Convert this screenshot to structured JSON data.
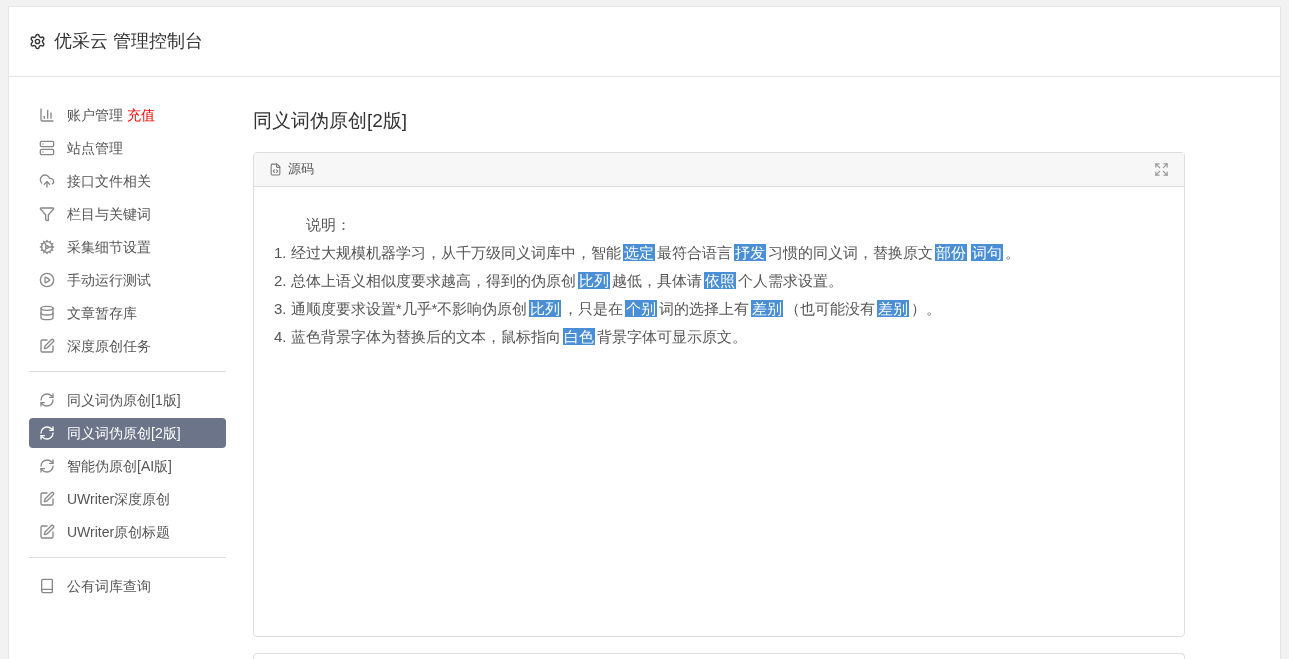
{
  "header": {
    "title": "优采云 管理控制台"
  },
  "sidebar": {
    "groups": [
      [
        {
          "label": "账户管理",
          "badge": "充值",
          "selected": false
        },
        {
          "label": "站点管理",
          "selected": false
        },
        {
          "label": "接口文件相关",
          "selected": false
        },
        {
          "label": "栏目与关键词",
          "selected": false
        },
        {
          "label": "采集细节设置",
          "selected": false
        },
        {
          "label": "手动运行测试",
          "selected": false
        },
        {
          "label": "文章暂存库",
          "selected": false
        },
        {
          "label": "深度原创任务",
          "selected": false
        }
      ],
      [
        {
          "label": "同义词伪原创[1版]",
          "selected": false
        },
        {
          "label": "同义词伪原创[2版]",
          "selected": true
        },
        {
          "label": "智能伪原创[AI版]",
          "selected": false
        },
        {
          "label": "UWriter深度原创",
          "selected": false
        },
        {
          "label": "UWriter原创标题",
          "selected": false
        }
      ],
      [
        {
          "label": "公有词库查询",
          "selected": false
        }
      ]
    ]
  },
  "content": {
    "title": "同义词伪原创[2版]",
    "source_panel": {
      "title": "源码",
      "heading": "说明：",
      "lines": [
        [
          {
            "text": "1. 经过大规模机器学习，从千万级同义词库中，智能",
            "highlighted": false
          },
          {
            "text": "选定",
            "highlighted": true
          },
          {
            "text": "最符合语言",
            "highlighted": false
          },
          {
            "text": "抒发",
            "highlighted": true
          },
          {
            "text": "习惯的同义词，替换原文",
            "highlighted": false
          },
          {
            "text": "部份",
            "highlighted": true
          },
          {
            "text": "词句",
            "highlighted": true
          },
          {
            "text": "。",
            "highlighted": false
          }
        ],
        [
          {
            "text": "2. 总体上语义相似度要求越高，得到的伪原创",
            "highlighted": false
          },
          {
            "text": "比列",
            "highlighted": true
          },
          {
            "text": "越低，具体请",
            "highlighted": false
          },
          {
            "text": "依照",
            "highlighted": true
          },
          {
            "text": "个人需求设置。",
            "highlighted": false
          }
        ],
        [
          {
            "text": "3. 通顺度要求设置*几乎*不影响伪原创",
            "highlighted": false
          },
          {
            "text": "比列",
            "highlighted": true
          },
          {
            "text": "，只是在",
            "highlighted": false
          },
          {
            "text": "个别",
            "highlighted": true
          },
          {
            "text": "词的选择上有",
            "highlighted": false
          },
          {
            "text": "差别",
            "highlighted": true
          },
          {
            "text": "（也可能没有",
            "highlighted": false
          },
          {
            "text": "差别",
            "highlighted": true
          },
          {
            "text": "）。",
            "highlighted": false
          }
        ],
        [
          {
            "text": "4. 蓝色背景字体为替换后的文本，鼠标指向",
            "highlighted": false
          },
          {
            "text": "白色",
            "highlighted": true
          },
          {
            "text": "背景字体可显示原文。",
            "highlighted": false
          }
        ]
      ]
    }
  }
}
